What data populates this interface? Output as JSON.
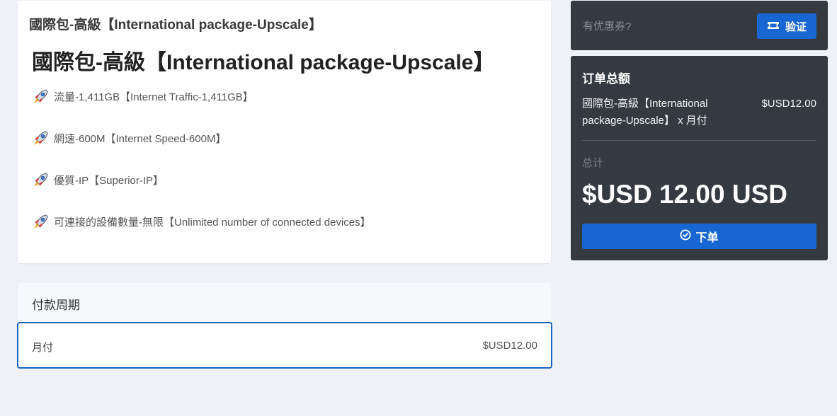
{
  "product": {
    "small_title": "國際包-高級【International package-Upscale】",
    "title": "國際包-高級【International package-Upscale】",
    "features": [
      {
        "icon": "rocket-icon",
        "text": "流量-1,411GB【Internet Traffic-1,411GB】"
      },
      {
        "icon": "rocket-icon",
        "text": "網速-600M【Internet Speed-600M】"
      },
      {
        "icon": "rocket-icon",
        "text": "優質-IP【Superior-IP】"
      },
      {
        "icon": "rocket-icon",
        "text": "可連接的設備數量-無限【Unlimited number of connected devices】"
      }
    ]
  },
  "billing_cycle": {
    "header": "付款周期",
    "options": [
      {
        "label": "月付",
        "price": "$USD12.00",
        "selected": true
      }
    ]
  },
  "coupon": {
    "placeholder": "有优惠券?",
    "verify_label": "验证",
    "verify_icon": "ticket-icon"
  },
  "order_summary": {
    "title": "订单总额",
    "item_name": "國際包-高級【International package-Upscale】 x 月付",
    "item_price": "$USD12.00",
    "total_label": "总计",
    "total_value": "$USD 12.00 USD",
    "order_label": "下单",
    "order_icon": "check-circle-icon"
  },
  "colors": {
    "accent": "#1766d1",
    "dark_panel": "#353a41",
    "page_bg": "#eef1f6"
  }
}
